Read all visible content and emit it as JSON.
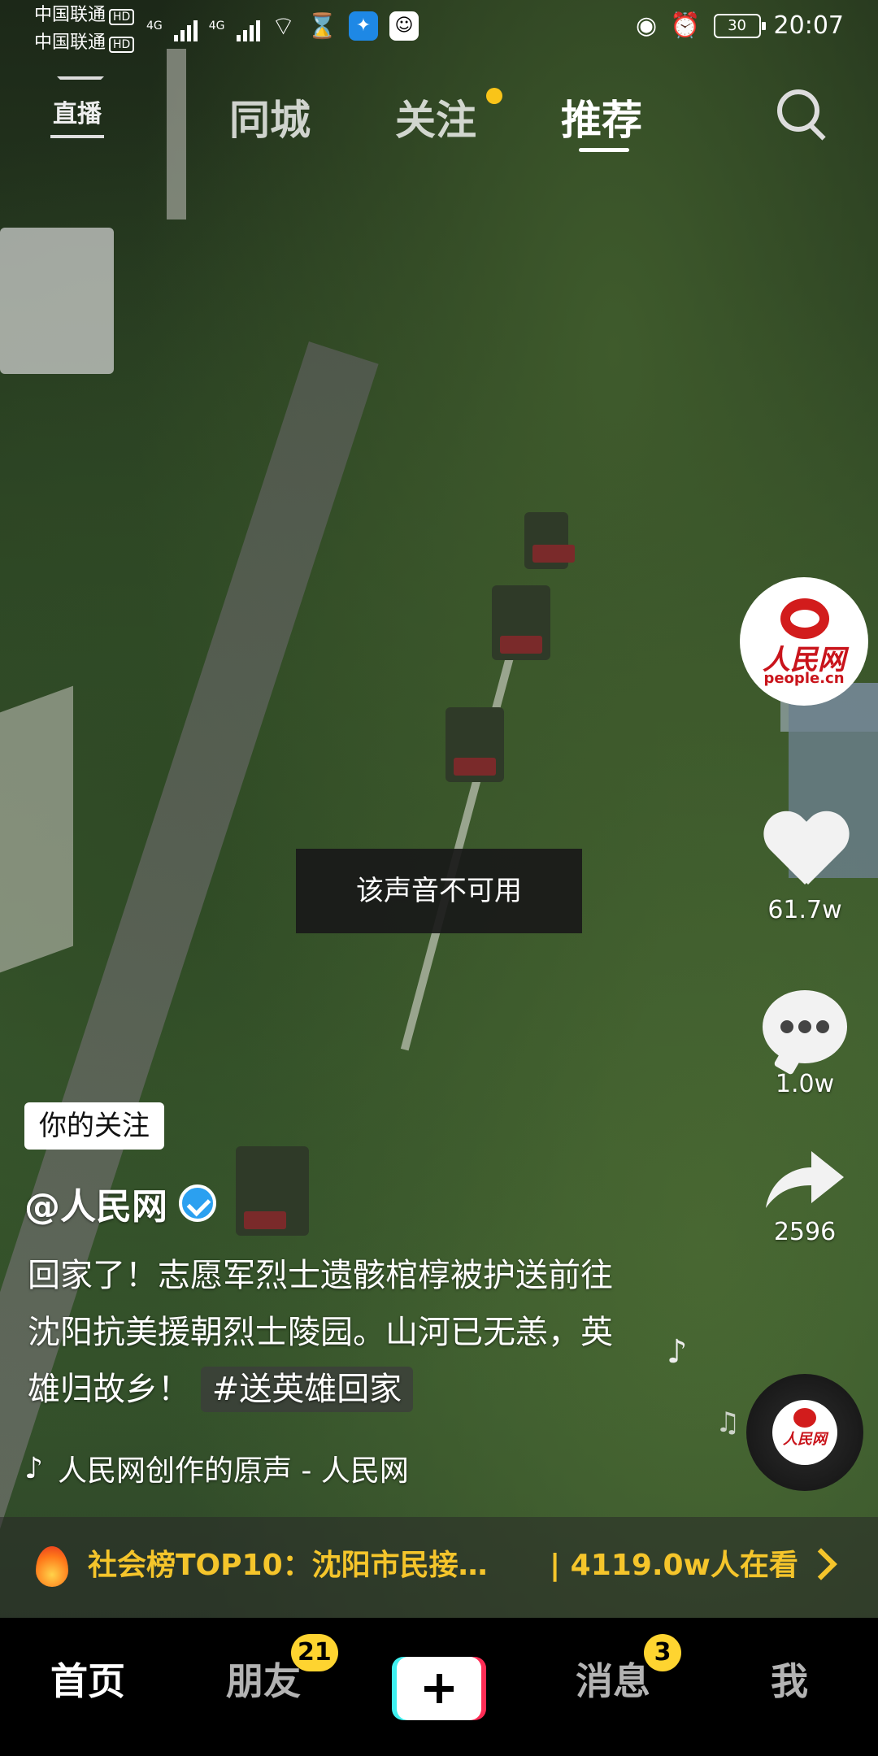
{
  "status_bar": {
    "carrier_1": "中国联通",
    "carrier_2": "中国联通",
    "hd": "HD",
    "network": "4G",
    "battery": "30",
    "time": "20:07"
  },
  "top_nav": {
    "live": "直播",
    "tabs": [
      "同城",
      "关注",
      "推荐"
    ],
    "active_tab": "推荐"
  },
  "toast": "该声音不可用",
  "actions": {
    "likes": "61.7w",
    "comments": "1.0w",
    "shares": "2596"
  },
  "avatar": {
    "logo_cn": "人民网",
    "logo_en": "people.cn"
  },
  "disc": {
    "logo_cn": "人民网"
  },
  "post": {
    "follow_tag": "你的关注",
    "author": "@人民网",
    "caption": "回家了！志愿军烈士遗骸棺椁被护送前往沈阳抗美援朝烈士陵园。山河已无恙，英雄归故乡！",
    "hashtag": "#送英雄回家",
    "music": "人民网创作的原声 - 人民网"
  },
  "hot": {
    "text": "社会榜TOP10：沈阳市民接…",
    "viewers": "| 4119.0w人在看"
  },
  "bottom_tabs": {
    "home": "首页",
    "friends": "朋友",
    "friends_badge": "21",
    "messages": "消息",
    "messages_badge": "3",
    "me": "我"
  },
  "colors": {
    "accent_yellow": "#f5c52b",
    "badge_yellow": "#fed430",
    "verified_blue": "#2ba0f0"
  }
}
